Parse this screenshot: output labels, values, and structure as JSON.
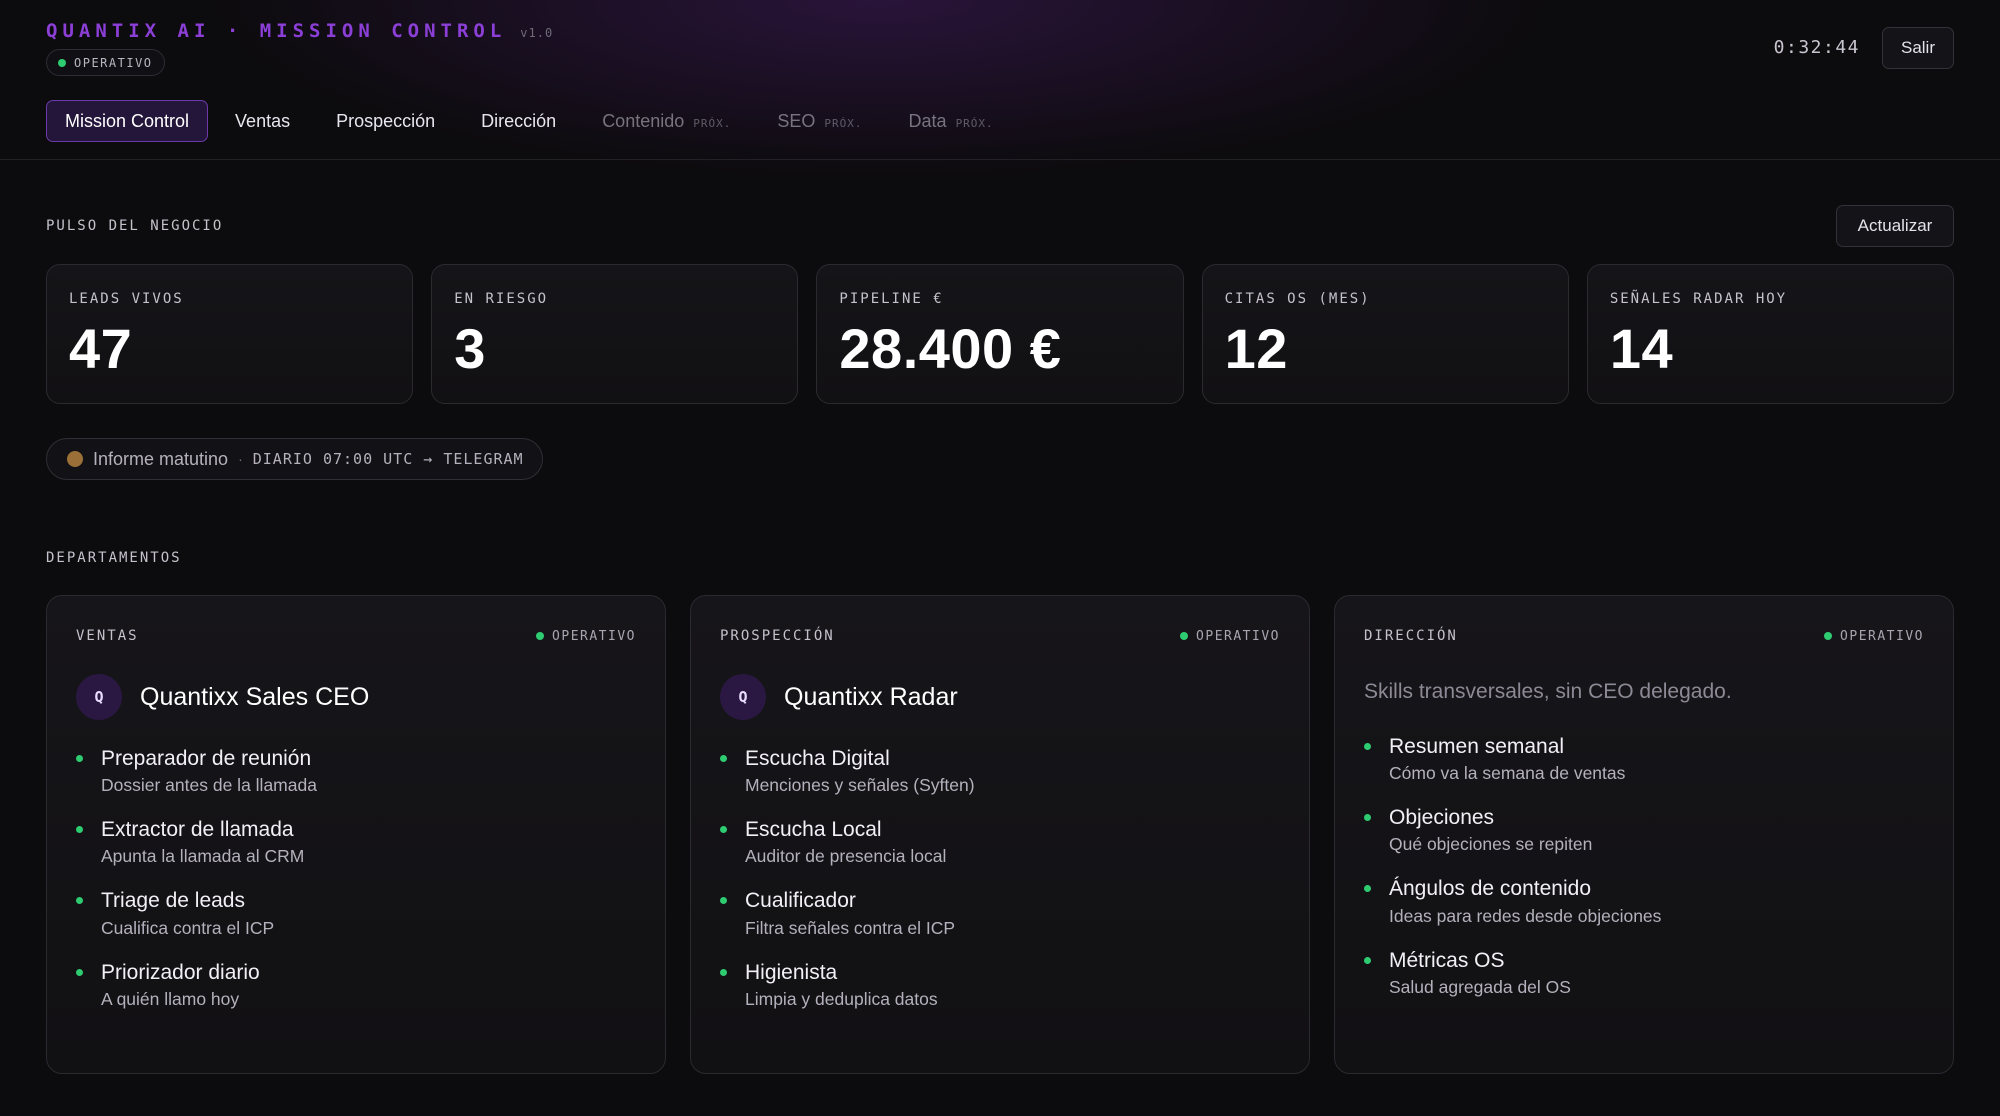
{
  "header": {
    "brand_title": "QUANTIX AI · MISSION CONTROL",
    "version": "v1.0",
    "status_label": "OPERATIVO",
    "clock": "0:32:44",
    "logout_label": "Salir"
  },
  "nav": {
    "tabs": [
      {
        "label": "Mission Control",
        "active": true
      },
      {
        "label": "Ventas"
      },
      {
        "label": "Prospección"
      },
      {
        "label": "Dirección"
      },
      {
        "label": "Contenido",
        "soon": "PRÓX."
      },
      {
        "label": "SEO",
        "soon": "PRÓX."
      },
      {
        "label": "Data",
        "soon": "PRÓX."
      }
    ]
  },
  "pulse": {
    "title": "PULSO DEL NEGOCIO",
    "refresh_label": "Actualizar",
    "kpis": [
      {
        "label": "LEADS VIVOS",
        "value": "47"
      },
      {
        "label": "EN RIESGO",
        "value": "3"
      },
      {
        "label": "PIPELINE €",
        "value": "28.400 €"
      },
      {
        "label": "CITAS OS (MES)",
        "value": "12"
      },
      {
        "label": "SEÑALES RADAR HOY",
        "value": "14"
      }
    ],
    "report": {
      "title": "Informe matutino",
      "separator": "·",
      "schedule": "DIARIO 07:00 UTC → TELEGRAM"
    }
  },
  "departments": {
    "title": "DEPARTAMENTOS",
    "items": [
      {
        "name": "VENTAS",
        "status": "OPERATIVO",
        "avatar": "Q",
        "agent": "Quantixx Sales CEO",
        "skills": [
          {
            "title": "Preparador de reunión",
            "desc": "Dossier antes de la llamada"
          },
          {
            "title": "Extractor de llamada",
            "desc": "Apunta la llamada al CRM"
          },
          {
            "title": "Triage de leads",
            "desc": "Cualifica contra el ICP"
          },
          {
            "title": "Priorizador diario",
            "desc": "A quién llamo hoy"
          }
        ]
      },
      {
        "name": "PROSPECCIÓN",
        "status": "OPERATIVO",
        "avatar": "Q",
        "agent": "Quantixx Radar",
        "skills": [
          {
            "title": "Escucha Digital",
            "desc": "Menciones y señales (Syften)"
          },
          {
            "title": "Escucha Local",
            "desc": "Auditor de presencia local"
          },
          {
            "title": "Cualificador",
            "desc": "Filtra señales contra el ICP"
          },
          {
            "title": "Higienista",
            "desc": "Limpia y deduplica datos"
          }
        ]
      },
      {
        "name": "DIRECCIÓN",
        "status": "OPERATIVO",
        "description": "Skills transversales, sin CEO delegado.",
        "skills": [
          {
            "title": "Resumen semanal",
            "desc": "Cómo va la semana de ventas"
          },
          {
            "title": "Objeciones",
            "desc": "Qué objeciones se repiten"
          },
          {
            "title": "Ángulos de contenido",
            "desc": "Ideas para redes desde objeciones"
          },
          {
            "title": "Métricas OS",
            "desc": "Salud agregada del OS"
          }
        ]
      }
    ]
  },
  "colors": {
    "brand": "#8b3fd6",
    "status_ok": "#2ecc71",
    "report_dot": "#9a7038",
    "active_tab_bg": "#24153a",
    "active_tab_border": "#6a3aa8"
  }
}
